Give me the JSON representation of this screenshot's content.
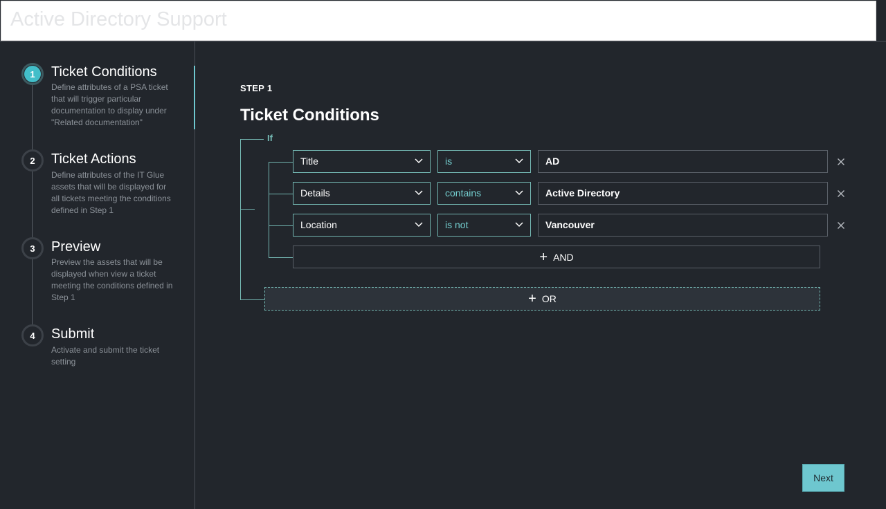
{
  "header": {
    "title": "Active Directory Support"
  },
  "sidebar": {
    "steps": [
      {
        "number": "1",
        "name": "Ticket Conditions",
        "description": "Define attributes of a PSA ticket that will trigger particular documentation to display under \"Related documentation\"",
        "active": true
      },
      {
        "number": "2",
        "name": "Ticket Actions",
        "description": "Define attributes of the IT Glue assets that will be displayed for all tickets meeting the conditions defined in Step 1"
      },
      {
        "number": "3",
        "name": "Preview",
        "description": "Preview the assets that will be displayed when view a ticket meeting the conditions defined in Step 1"
      },
      {
        "number": "4",
        "name": "Submit",
        "description": "Activate and submit the ticket setting"
      }
    ]
  },
  "main": {
    "step_label": "STEP 1",
    "title": "Ticket Conditions",
    "if_label": "If",
    "conditions": [
      {
        "field": "Title",
        "operator": "is",
        "value": "AD"
      },
      {
        "field": "Details",
        "operator": "contains",
        "value": "Active Directory"
      },
      {
        "field": "Location",
        "operator": "is not",
        "value": "Vancouver"
      }
    ],
    "and_label": "AND",
    "or_label": "OR",
    "next_label": "Next"
  },
  "colors": {
    "accent": "#6ec7cf",
    "connector": "#74b8b3",
    "background": "#22262c",
    "active_step": "#42bec9"
  },
  "icons": {
    "chevron": "chevron-down-icon",
    "remove": "close-icon",
    "add": "plus-icon"
  }
}
